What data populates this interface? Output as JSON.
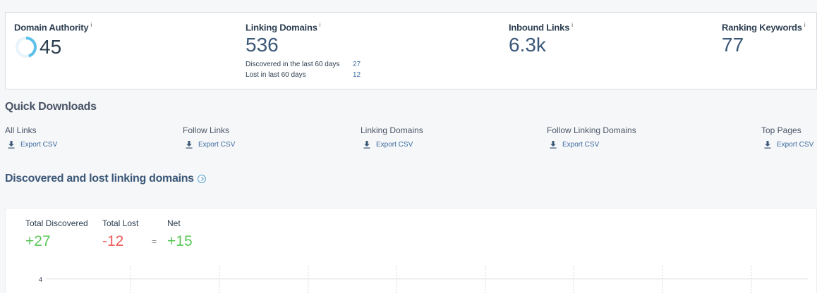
{
  "metrics": {
    "domain_authority": {
      "label": "Domain Authority",
      "info": "i",
      "value": "45",
      "ring_fraction": 0.45
    },
    "linking_domains": {
      "label": "Linking Domains",
      "info": "i",
      "value": "536",
      "discovered_label": "Discovered in the last 60 days",
      "discovered_value": "27",
      "lost_label": "Lost in last 60 days",
      "lost_value": "12"
    },
    "inbound_links": {
      "label": "Inbound Links",
      "info": "i",
      "value": "6.3k"
    },
    "ranking_keywords": {
      "label": "Ranking Keywords",
      "info": "i",
      "value": "77"
    }
  },
  "quick_downloads": {
    "title": "Quick Downloads",
    "items": [
      {
        "label": "All Links",
        "action": "Export CSV"
      },
      {
        "label": "Follow Links",
        "action": "Export CSV"
      },
      {
        "label": "Linking Domains",
        "action": "Export CSV"
      },
      {
        "label": "Follow Linking Domains",
        "action": "Export CSV"
      },
      {
        "label": "Top Pages",
        "action": "Export CSV"
      }
    ]
  },
  "discovered_lost": {
    "title": "Discovered and lost linking domains",
    "total_discovered_label": "Total Discovered",
    "total_discovered_value": "+27",
    "total_lost_label": "Total Lost",
    "total_lost_value": "-12",
    "equals": "=",
    "net_label": "Net",
    "net_value": "+15",
    "chart_axis_tick": "4"
  },
  "colors": {
    "positive": "#5cc85a",
    "negative": "#f05a5a",
    "accent": "#3b5878",
    "ring": "#5bc0eb"
  },
  "icons": {
    "info": "info-circle-icon",
    "download": "download-icon"
  }
}
